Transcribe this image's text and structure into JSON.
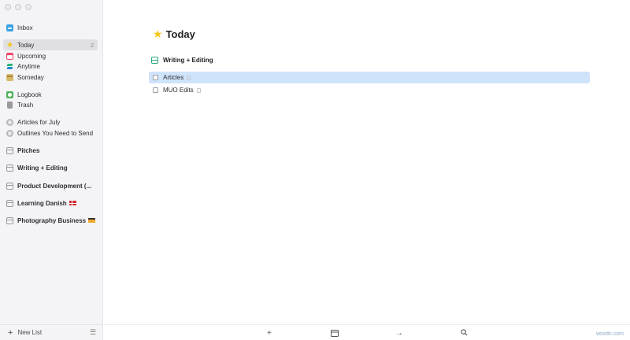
{
  "sidebar": {
    "inbox": "Inbox",
    "today": "Today",
    "today_count": "2",
    "upcoming": "Upcoming",
    "anytime": "Anytime",
    "someday": "Someday",
    "logbook": "Logbook",
    "trash": "Trash",
    "projects": [
      "Articles for July",
      "Outlines You Need to Send"
    ],
    "areas": [
      "Pitches",
      "Writing + Editing",
      "Product Development (...",
      "Learning Danish",
      "Photography Business"
    ],
    "footer": {
      "new_list": "New List"
    }
  },
  "main": {
    "title": "Today",
    "heading": "Writing + Editing",
    "tasks": [
      {
        "label": "Articles",
        "selected": true
      },
      {
        "label": "MUO Edits",
        "selected": false
      }
    ]
  },
  "toolbar": {
    "icons": [
      "plus-icon",
      "calendar-icon",
      "arrow-right-icon",
      "search-icon"
    ]
  },
  "watermark": "wsxdn.com",
  "colors": {
    "selected_task": "#cfe3fb",
    "star": "#f5c518",
    "accent": "#3aa3e6"
  }
}
